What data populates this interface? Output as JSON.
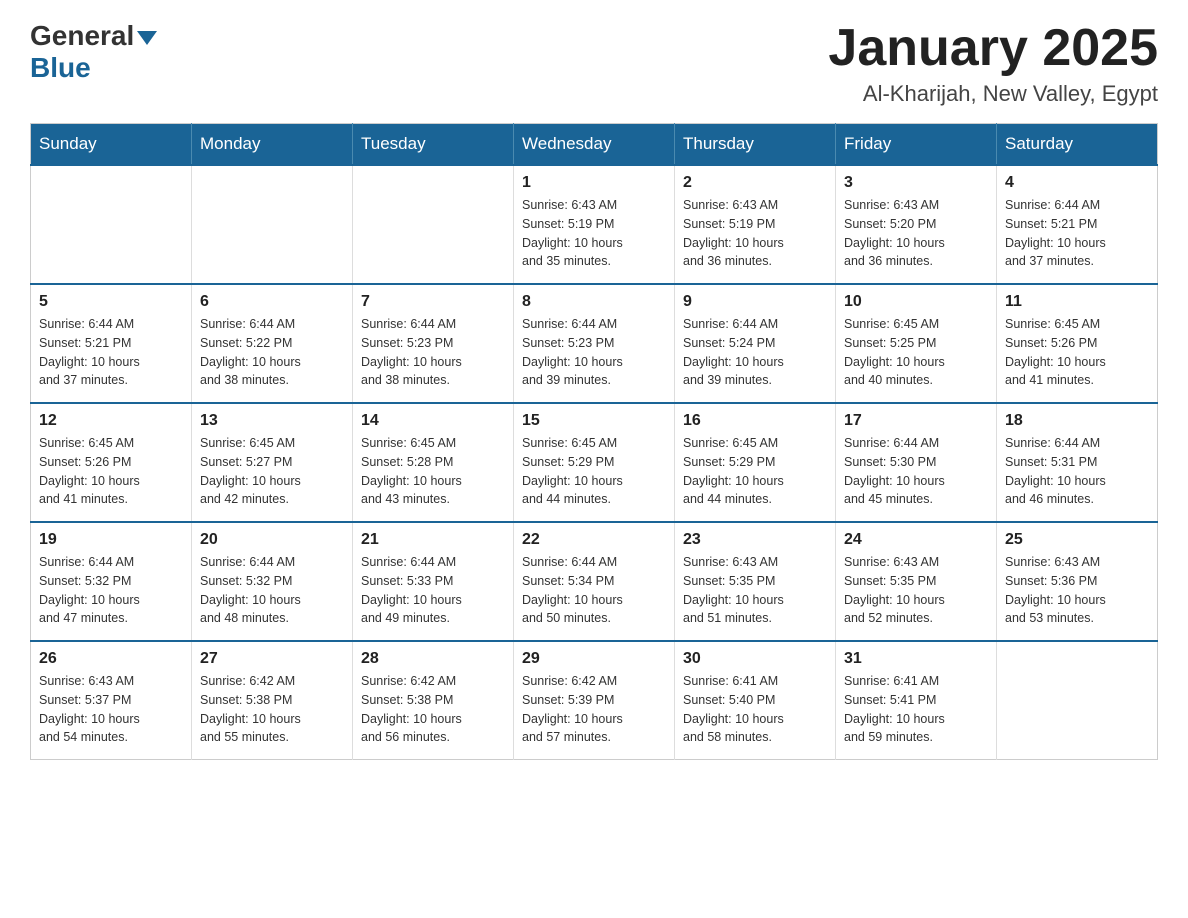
{
  "header": {
    "logo_general": "General",
    "logo_blue": "Blue",
    "month_title": "January 2025",
    "location": "Al-Kharijah, New Valley, Egypt"
  },
  "days_of_week": [
    "Sunday",
    "Monday",
    "Tuesday",
    "Wednesday",
    "Thursday",
    "Friday",
    "Saturday"
  ],
  "weeks": [
    [
      {
        "day": "",
        "info": ""
      },
      {
        "day": "",
        "info": ""
      },
      {
        "day": "",
        "info": ""
      },
      {
        "day": "1",
        "info": "Sunrise: 6:43 AM\nSunset: 5:19 PM\nDaylight: 10 hours\nand 35 minutes."
      },
      {
        "day": "2",
        "info": "Sunrise: 6:43 AM\nSunset: 5:19 PM\nDaylight: 10 hours\nand 36 minutes."
      },
      {
        "day": "3",
        "info": "Sunrise: 6:43 AM\nSunset: 5:20 PM\nDaylight: 10 hours\nand 36 minutes."
      },
      {
        "day": "4",
        "info": "Sunrise: 6:44 AM\nSunset: 5:21 PM\nDaylight: 10 hours\nand 37 minutes."
      }
    ],
    [
      {
        "day": "5",
        "info": "Sunrise: 6:44 AM\nSunset: 5:21 PM\nDaylight: 10 hours\nand 37 minutes."
      },
      {
        "day": "6",
        "info": "Sunrise: 6:44 AM\nSunset: 5:22 PM\nDaylight: 10 hours\nand 38 minutes."
      },
      {
        "day": "7",
        "info": "Sunrise: 6:44 AM\nSunset: 5:23 PM\nDaylight: 10 hours\nand 38 minutes."
      },
      {
        "day": "8",
        "info": "Sunrise: 6:44 AM\nSunset: 5:23 PM\nDaylight: 10 hours\nand 39 minutes."
      },
      {
        "day": "9",
        "info": "Sunrise: 6:44 AM\nSunset: 5:24 PM\nDaylight: 10 hours\nand 39 minutes."
      },
      {
        "day": "10",
        "info": "Sunrise: 6:45 AM\nSunset: 5:25 PM\nDaylight: 10 hours\nand 40 minutes."
      },
      {
        "day": "11",
        "info": "Sunrise: 6:45 AM\nSunset: 5:26 PM\nDaylight: 10 hours\nand 41 minutes."
      }
    ],
    [
      {
        "day": "12",
        "info": "Sunrise: 6:45 AM\nSunset: 5:26 PM\nDaylight: 10 hours\nand 41 minutes."
      },
      {
        "day": "13",
        "info": "Sunrise: 6:45 AM\nSunset: 5:27 PM\nDaylight: 10 hours\nand 42 minutes."
      },
      {
        "day": "14",
        "info": "Sunrise: 6:45 AM\nSunset: 5:28 PM\nDaylight: 10 hours\nand 43 minutes."
      },
      {
        "day": "15",
        "info": "Sunrise: 6:45 AM\nSunset: 5:29 PM\nDaylight: 10 hours\nand 44 minutes."
      },
      {
        "day": "16",
        "info": "Sunrise: 6:45 AM\nSunset: 5:29 PM\nDaylight: 10 hours\nand 44 minutes."
      },
      {
        "day": "17",
        "info": "Sunrise: 6:44 AM\nSunset: 5:30 PM\nDaylight: 10 hours\nand 45 minutes."
      },
      {
        "day": "18",
        "info": "Sunrise: 6:44 AM\nSunset: 5:31 PM\nDaylight: 10 hours\nand 46 minutes."
      }
    ],
    [
      {
        "day": "19",
        "info": "Sunrise: 6:44 AM\nSunset: 5:32 PM\nDaylight: 10 hours\nand 47 minutes."
      },
      {
        "day": "20",
        "info": "Sunrise: 6:44 AM\nSunset: 5:32 PM\nDaylight: 10 hours\nand 48 minutes."
      },
      {
        "day": "21",
        "info": "Sunrise: 6:44 AM\nSunset: 5:33 PM\nDaylight: 10 hours\nand 49 minutes."
      },
      {
        "day": "22",
        "info": "Sunrise: 6:44 AM\nSunset: 5:34 PM\nDaylight: 10 hours\nand 50 minutes."
      },
      {
        "day": "23",
        "info": "Sunrise: 6:43 AM\nSunset: 5:35 PM\nDaylight: 10 hours\nand 51 minutes."
      },
      {
        "day": "24",
        "info": "Sunrise: 6:43 AM\nSunset: 5:35 PM\nDaylight: 10 hours\nand 52 minutes."
      },
      {
        "day": "25",
        "info": "Sunrise: 6:43 AM\nSunset: 5:36 PM\nDaylight: 10 hours\nand 53 minutes."
      }
    ],
    [
      {
        "day": "26",
        "info": "Sunrise: 6:43 AM\nSunset: 5:37 PM\nDaylight: 10 hours\nand 54 minutes."
      },
      {
        "day": "27",
        "info": "Sunrise: 6:42 AM\nSunset: 5:38 PM\nDaylight: 10 hours\nand 55 minutes."
      },
      {
        "day": "28",
        "info": "Sunrise: 6:42 AM\nSunset: 5:38 PM\nDaylight: 10 hours\nand 56 minutes."
      },
      {
        "day": "29",
        "info": "Sunrise: 6:42 AM\nSunset: 5:39 PM\nDaylight: 10 hours\nand 57 minutes."
      },
      {
        "day": "30",
        "info": "Sunrise: 6:41 AM\nSunset: 5:40 PM\nDaylight: 10 hours\nand 58 minutes."
      },
      {
        "day": "31",
        "info": "Sunrise: 6:41 AM\nSunset: 5:41 PM\nDaylight: 10 hours\nand 59 minutes."
      },
      {
        "day": "",
        "info": ""
      }
    ]
  ]
}
